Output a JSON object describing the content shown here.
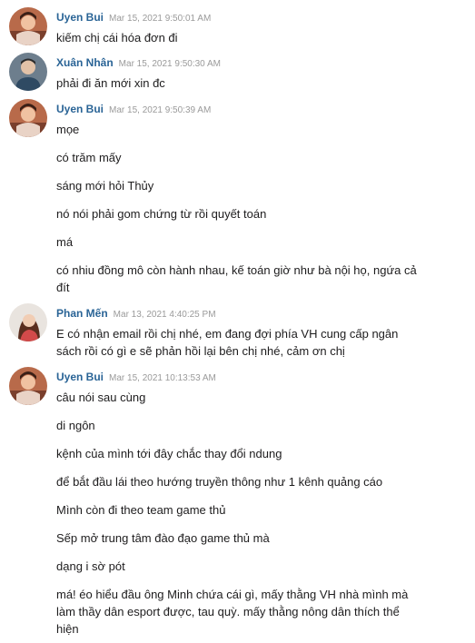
{
  "messages": [
    {
      "author": "Uyen Bui",
      "time": "Mar 15, 2021 9:50:01 AM",
      "lines": [
        "kiếm chị cái hóa đơn đi"
      ]
    },
    {
      "author": "Xuân Nhân",
      "time": "Mar 15, 2021 9:50:30 AM",
      "lines": [
        "phải đi ăn mới xin đc"
      ]
    },
    {
      "author": "Uyen Bui",
      "time": "Mar 15, 2021 9:50:39 AM",
      "lines": [
        "mọe",
        "có trăm mấy",
        "sáng mới hỏi Thủy",
        "nó nói phải gom chứng từ rồi quyết toán",
        "má",
        "có nhiu đồng mô còn hành nhau, kế toán giờ như bà nội họ, ngứa cả đít"
      ]
    },
    {
      "author": "Phan Mến",
      "time": "Mar 13, 2021 4:40:25 PM",
      "lines": [
        "E có nhận email rồi chị nhé, em đang đợi phía VH cung cấp ngân sách rồi có gì e sẽ phản hồi lại bên chị nhé, cảm ơn chị"
      ]
    },
    {
      "author": "Uyen Bui",
      "time": "Mar 15, 2021 10:13:53 AM",
      "lines": [
        "câu nói sau cùng",
        "di ngôn",
        "kệnh của mình tới đây chắc thay đổi ndung",
        "để bắt đầu lái theo hướng truyền thông như 1 kênh quảng cáo",
        "Mình còn đi theo team game thủ",
        "Sếp mở trung tâm đào đạo game thủ mà",
        "dạng i sờ pót",
        "má! éo hiểu đầu ông Minh chứa cái gì, mấy thằng VH nhà mình mà làm thầy dân esport được, tau quỳ. mấy thằng nông dân thích thể hiện"
      ]
    }
  ]
}
